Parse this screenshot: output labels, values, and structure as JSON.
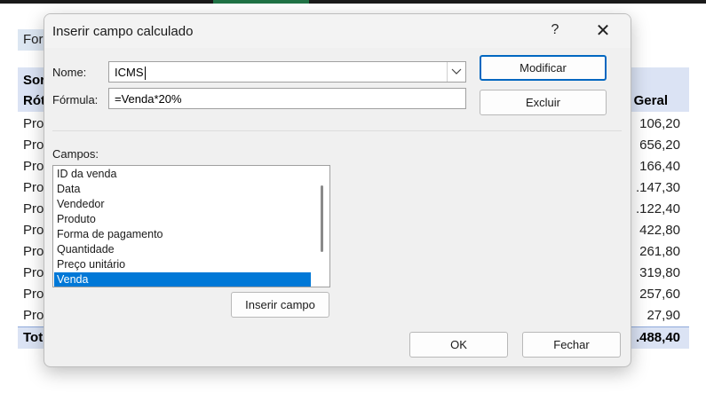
{
  "sheet": {
    "fora_label": "For",
    "header": {
      "line1": "Sor",
      "line2": "Rót",
      "right": "Geral"
    },
    "rows": [
      {
        "label": "Pro",
        "value": "106,20"
      },
      {
        "label": "Pro",
        "value": "656,20"
      },
      {
        "label": "Pro",
        "value": "166,40"
      },
      {
        "label": "Pro",
        "value": ".147,30"
      },
      {
        "label": "Pro",
        "value": ".122,40"
      },
      {
        "label": "Pro",
        "value": "422,80"
      },
      {
        "label": "Pro",
        "value": "261,80"
      },
      {
        "label": "Pro",
        "value": "319,80"
      },
      {
        "label": "Pro",
        "value": "257,60"
      },
      {
        "label": "Pro",
        "value": "27,90"
      }
    ],
    "total": {
      "label": "Tot",
      "value": ".488,40"
    }
  },
  "dialog": {
    "title": "Inserir campo calculado",
    "help_glyph": "?",
    "close_glyph": "✕",
    "name_label": "Nome:",
    "name_value": "ICMS",
    "formula_label": "Fórmula:",
    "formula_value": "=Venda*20%",
    "modify_button": "Modificar",
    "delete_button": "Excluir",
    "fields_label": "Campos:",
    "fields": [
      "ID da venda",
      "Data",
      "Vendedor",
      "Produto",
      "Forma de pagamento",
      "Quantidade",
      "Preço unitário",
      "Venda"
    ],
    "selected_field": "Venda",
    "insert_field_button": "Inserir campo",
    "ok_button": "OK",
    "close_button": "Fechar",
    "icons": {
      "dropdown": "chevron-down-icon",
      "close": "close-icon",
      "help": "help-icon"
    },
    "colors": {
      "selection": "#0078d7",
      "primary_border": "#0067c0",
      "header_fill": "#dbe3f4"
    }
  }
}
